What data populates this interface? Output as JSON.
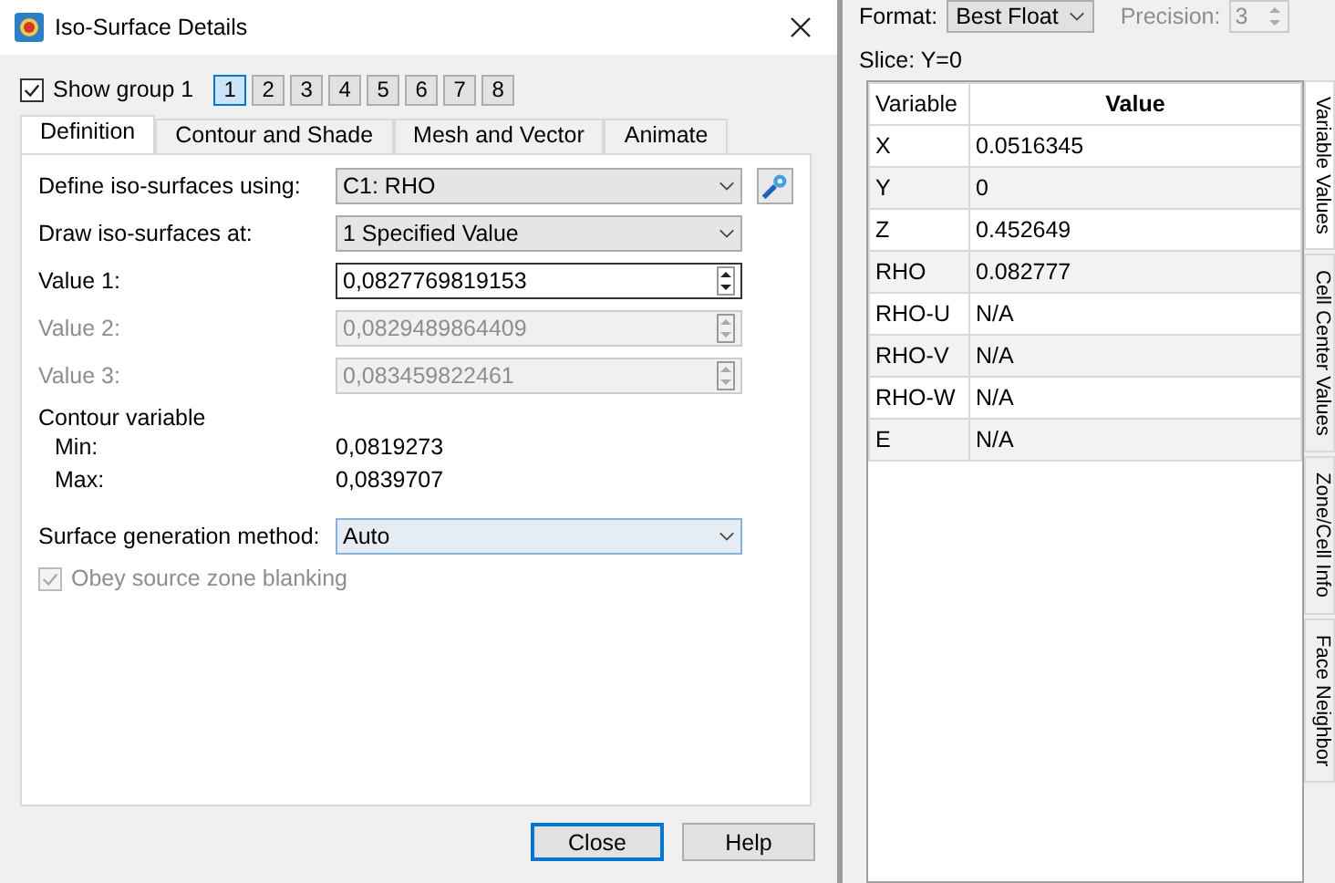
{
  "window": {
    "title": "Iso-Surface Details"
  },
  "show_group": {
    "label": "Show group 1",
    "checked": true
  },
  "groups": [
    {
      "label": "1",
      "selected": true
    },
    {
      "label": "2",
      "selected": false
    },
    {
      "label": "3",
      "selected": false
    },
    {
      "label": "4",
      "selected": false
    },
    {
      "label": "5",
      "selected": false
    },
    {
      "label": "6",
      "selected": false
    },
    {
      "label": "7",
      "selected": false
    },
    {
      "label": "8",
      "selected": false
    }
  ],
  "tabs": [
    {
      "label": "Definition",
      "selected": true
    },
    {
      "label": "Contour and Shade",
      "selected": false
    },
    {
      "label": "Mesh and Vector",
      "selected": false
    },
    {
      "label": "Animate",
      "selected": false
    }
  ],
  "fields": [
    {
      "kind": "dropdown",
      "label": "Define iso-surfaces using:",
      "value": "C1: RHO",
      "tool": true,
      "disabled": false
    },
    {
      "kind": "dropdown",
      "label": "Draw iso-surfaces at:",
      "value": "1 Specified Value",
      "tool": false,
      "disabled": false
    },
    {
      "kind": "spinner",
      "label": "Value 1:",
      "value": "0,0827769819153",
      "tool": false,
      "disabled": false
    },
    {
      "kind": "spinner",
      "label": "Value 2:",
      "value": "0,0829489864409",
      "tool": false,
      "disabled": true
    },
    {
      "kind": "spinner",
      "label": "Value 3:",
      "value": "0,083459822461",
      "tool": false,
      "disabled": true
    }
  ],
  "contour": {
    "title": "Contour variable",
    "min_label": "Min:",
    "min": "0,0819273",
    "max_label": "Max:",
    "max": "0,0839707"
  },
  "method": {
    "label": "Surface generation method:",
    "value": "Auto"
  },
  "obey": {
    "label": "Obey source zone blanking",
    "checked": true,
    "disabled": true
  },
  "buttons": [
    {
      "label": "Close",
      "default": true
    },
    {
      "label": "Help",
      "default": false
    }
  ],
  "probe": {
    "format_label": "Format:",
    "format": "Best Float",
    "precision_label": "Precision:",
    "precision": "3",
    "slice": "Slice: Y=0",
    "columns": [
      "Variable",
      "Value"
    ],
    "rows": [
      [
        "X",
        "0.0516345"
      ],
      [
        "Y",
        "0"
      ],
      [
        "Z",
        "0.452649"
      ],
      [
        "RHO",
        "0.082777"
      ],
      [
        "RHO-U",
        "N/A"
      ],
      [
        "RHO-V",
        "N/A"
      ],
      [
        "RHO-W",
        "N/A"
      ],
      [
        "E",
        "N/A"
      ]
    ],
    "side_tabs": [
      {
        "label": "Variable Values",
        "selected": true
      },
      {
        "label": "Cell Center Values",
        "selected": false
      },
      {
        "label": "Zone/Cell Info",
        "selected": false
      },
      {
        "label": "Face Neighbor",
        "selected": false
      }
    ]
  }
}
